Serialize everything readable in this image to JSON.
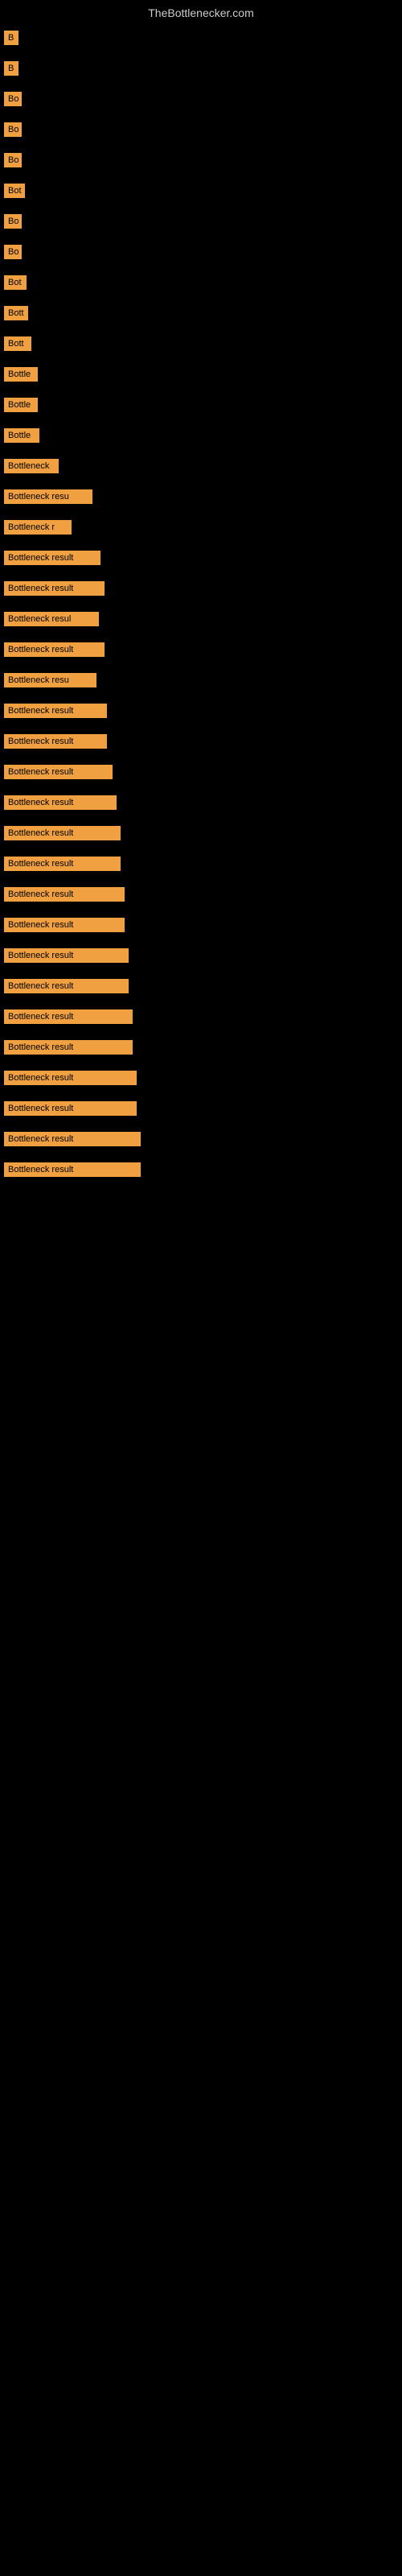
{
  "site": {
    "title": "TheBottlenecker.com"
  },
  "rows": [
    {
      "id": 1,
      "label": "B",
      "width": 18
    },
    {
      "id": 2,
      "label": "B",
      "width": 18
    },
    {
      "id": 3,
      "label": "Bo",
      "width": 22
    },
    {
      "id": 4,
      "label": "Bo",
      "width": 22
    },
    {
      "id": 5,
      "label": "Bo",
      "width": 22
    },
    {
      "id": 6,
      "label": "Bot",
      "width": 26
    },
    {
      "id": 7,
      "label": "Bo",
      "width": 22
    },
    {
      "id": 8,
      "label": "Bo",
      "width": 22
    },
    {
      "id": 9,
      "label": "Bot",
      "width": 28
    },
    {
      "id": 10,
      "label": "Bott",
      "width": 30
    },
    {
      "id": 11,
      "label": "Bott",
      "width": 34
    },
    {
      "id": 12,
      "label": "Bottle",
      "width": 42
    },
    {
      "id": 13,
      "label": "Bottle",
      "width": 42
    },
    {
      "id": 14,
      "label": "Bottle",
      "width": 44
    },
    {
      "id": 15,
      "label": "Bottleneck",
      "width": 68
    },
    {
      "id": 16,
      "label": "Bottleneck resu",
      "width": 110
    },
    {
      "id": 17,
      "label": "Bottleneck r",
      "width": 84
    },
    {
      "id": 18,
      "label": "Bottleneck result",
      "width": 120
    },
    {
      "id": 19,
      "label": "Bottleneck result",
      "width": 125
    },
    {
      "id": 20,
      "label": "Bottleneck resul",
      "width": 118
    },
    {
      "id": 21,
      "label": "Bottleneck result",
      "width": 125
    },
    {
      "id": 22,
      "label": "Bottleneck resu",
      "width": 115
    },
    {
      "id": 23,
      "label": "Bottleneck result",
      "width": 128
    },
    {
      "id": 24,
      "label": "Bottleneck result",
      "width": 128
    },
    {
      "id": 25,
      "label": "Bottleneck result",
      "width": 135
    },
    {
      "id": 26,
      "label": "Bottleneck result",
      "width": 140
    },
    {
      "id": 27,
      "label": "Bottleneck result",
      "width": 145
    },
    {
      "id": 28,
      "label": "Bottleneck result",
      "width": 145
    },
    {
      "id": 29,
      "label": "Bottleneck result",
      "width": 150
    },
    {
      "id": 30,
      "label": "Bottleneck result",
      "width": 150
    },
    {
      "id": 31,
      "label": "Bottleneck result",
      "width": 155
    },
    {
      "id": 32,
      "label": "Bottleneck result",
      "width": 155
    },
    {
      "id": 33,
      "label": "Bottleneck result",
      "width": 160
    },
    {
      "id": 34,
      "label": "Bottleneck result",
      "width": 160
    },
    {
      "id": 35,
      "label": "Bottleneck result",
      "width": 165
    },
    {
      "id": 36,
      "label": "Bottleneck result",
      "width": 165
    },
    {
      "id": 37,
      "label": "Bottleneck result",
      "width": 170
    },
    {
      "id": 38,
      "label": "Bottleneck result",
      "width": 170
    }
  ]
}
